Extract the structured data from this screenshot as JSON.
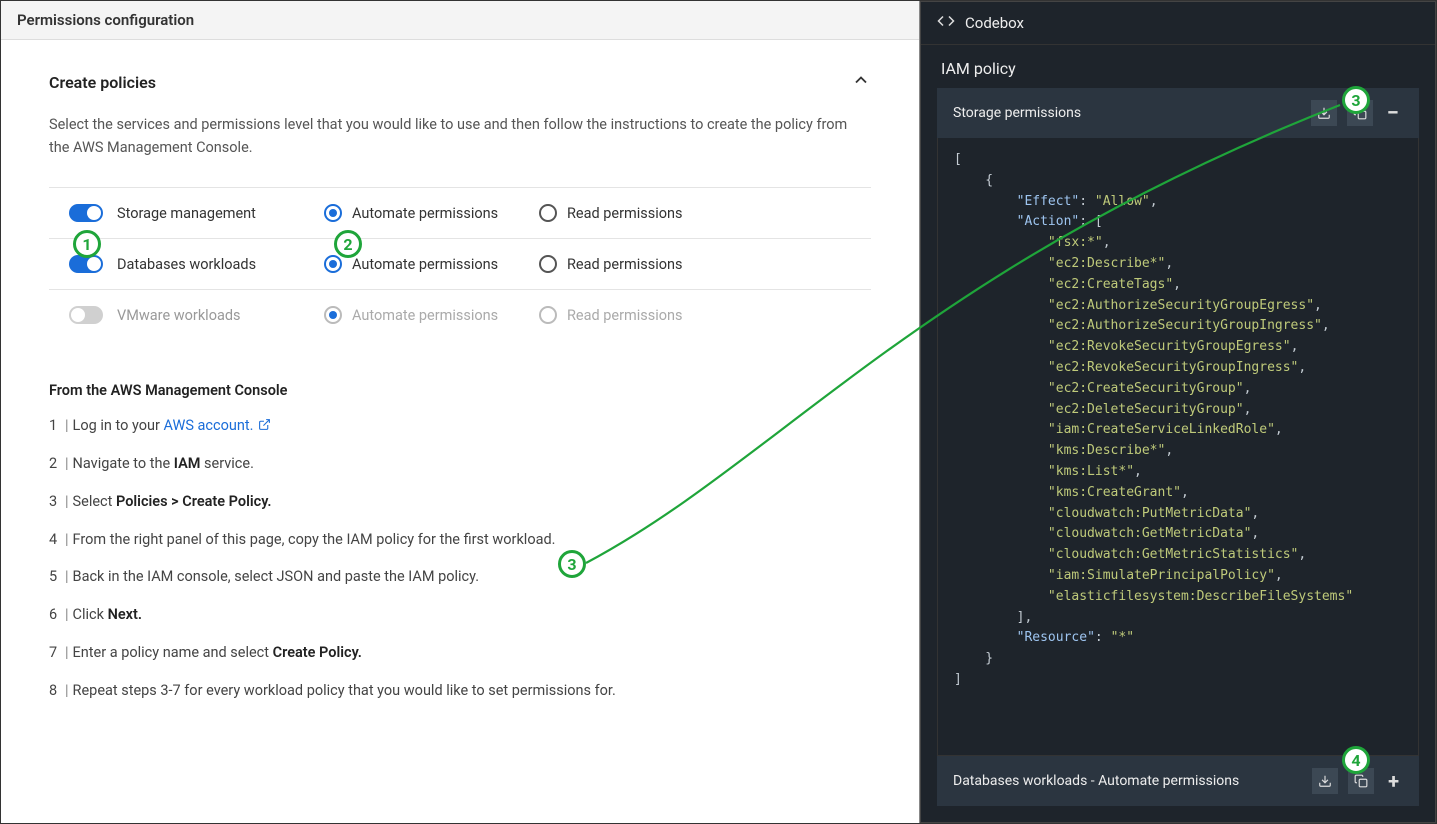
{
  "header": {
    "title": "Permissions configuration"
  },
  "card": {
    "title": "Create policies",
    "description": "Select the services and permissions level that you would like to use and then follow the instructions to create the policy from the AWS Management Console."
  },
  "services": [
    {
      "label": "Storage management",
      "enabled": true,
      "automate": "Automate permissions",
      "read": "Read permissions",
      "selected": "automate",
      "disabled": false
    },
    {
      "label": "Databases workloads",
      "enabled": true,
      "automate": "Automate permissions",
      "read": "Read permissions",
      "selected": "automate",
      "disabled": false
    },
    {
      "label": "VMware workloads",
      "enabled": false,
      "automate": "Automate permissions",
      "read": "Read permissions",
      "selected": "automate",
      "disabled": true
    }
  ],
  "instructions_title": "From the AWS Management Console",
  "instructions": {
    "s1_pre": "Log in to your ",
    "s1_link": "AWS account.",
    "s2_pre": "Navigate to the ",
    "s2_bold": "IAM",
    "s2_post": " service.",
    "s3_pre": "Select ",
    "s3_bold": "Policies > Create Policy.",
    "s4": "From the right panel of this page, copy the IAM policy for the first workload.",
    "s5": "Back in the IAM console, select JSON and paste the IAM policy.",
    "s6_pre": "Click ",
    "s6_bold": "Next.",
    "s7_pre": "Enter a policy name and select ",
    "s7_bold": "Create Policy.",
    "s8": "Repeat steps 3-7 for every workload policy that you would like to set permissions for."
  },
  "codebox": {
    "title": "Codebox",
    "iam_title": "IAM policy",
    "section1": "Storage permissions",
    "section2": "Databases workloads - Automate permissions",
    "policy": {
      "Effect": "Allow",
      "Action": [
        "fsx:*",
        "ec2:Describe*",
        "ec2:CreateTags",
        "ec2:AuthorizeSecurityGroupEgress",
        "ec2:AuthorizeSecurityGroupIngress",
        "ec2:RevokeSecurityGroupEgress",
        "ec2:RevokeSecurityGroupIngress",
        "ec2:CreateSecurityGroup",
        "ec2:DeleteSecurityGroup",
        "iam:CreateServiceLinkedRole",
        "kms:Describe*",
        "kms:List*",
        "kms:CreateGrant",
        "cloudwatch:PutMetricData",
        "cloudwatch:GetMetricData",
        "cloudwatch:GetMetricStatistics",
        "iam:SimulatePrincipalPolicy",
        "elasticfilesystem:DescribeFileSystems"
      ],
      "Resource": "*"
    }
  },
  "callouts": {
    "c1": "1",
    "c2": "2",
    "c3a": "3",
    "c3b": "3",
    "c4": "4"
  }
}
